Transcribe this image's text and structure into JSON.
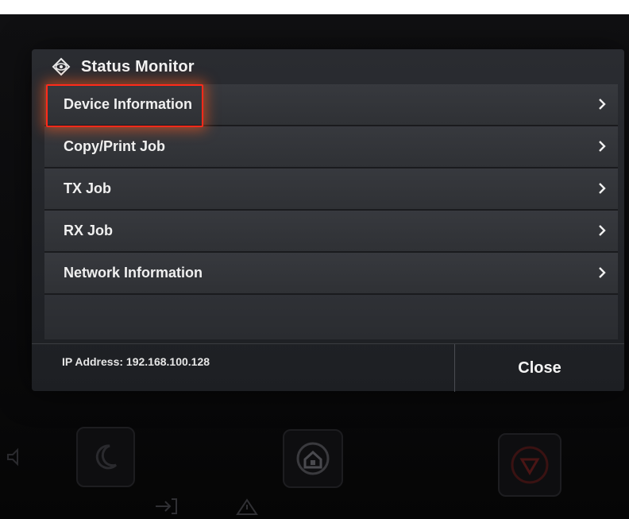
{
  "header": {
    "title": "Status Monitor",
    "icon": "eye-icon"
  },
  "menu": {
    "items": [
      {
        "label": "Device Information",
        "highlighted": true
      },
      {
        "label": "Copy/Print Job"
      },
      {
        "label": "TX Job"
      },
      {
        "label": "RX Job"
      },
      {
        "label": "Network Information"
      }
    ]
  },
  "footer": {
    "ip_text": "IP Address: 192.168.100.128",
    "close_label": "Close"
  },
  "colors": {
    "highlight": "#ff2a1a",
    "stop_button": "#8b1a1a"
  },
  "hardware": {
    "buttons": [
      "sleep-icon",
      "home-icon",
      "stop-icon"
    ]
  }
}
